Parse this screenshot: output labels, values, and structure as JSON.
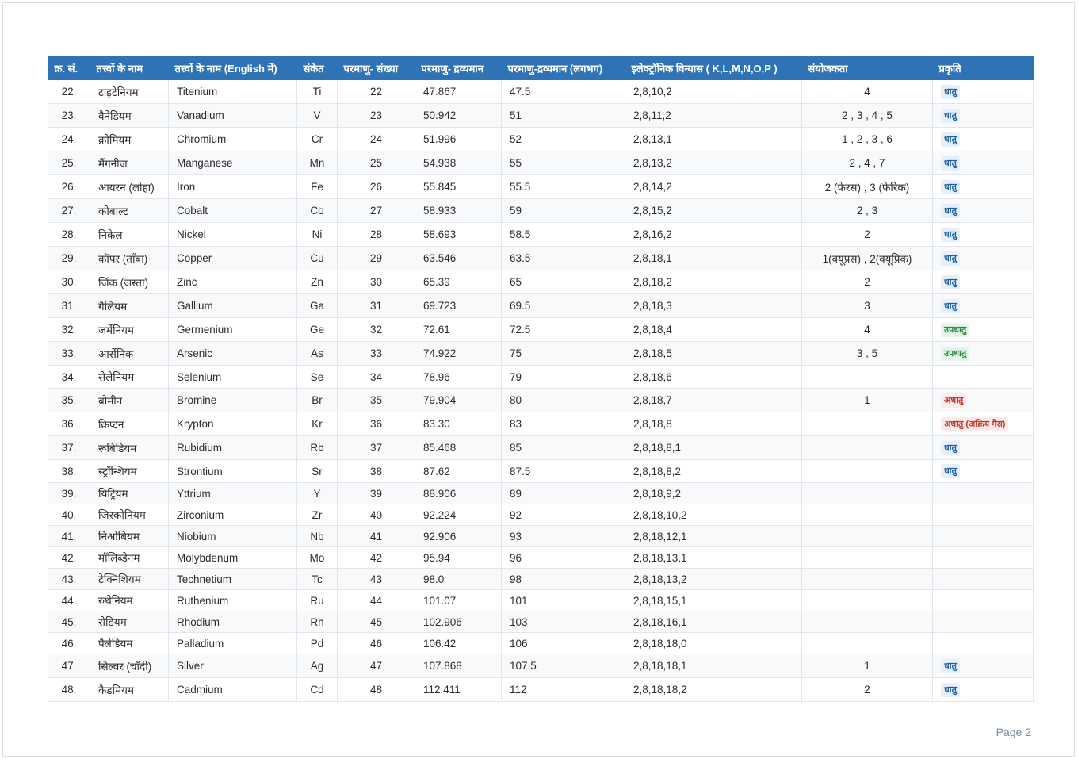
{
  "table": {
    "headers": [
      "क्र. सं.",
      "तत्त्वों के नाम",
      "तत्त्वों के नाम (English में)",
      "संकेत",
      "परमाणु- संख्या",
      "परमाणु- द्रव्यमान",
      "परमाणु-द्रव्यमान (लगभग)",
      "इलेक्ट्रॉनिक विन्यास ( K,L,M,N,O,P )",
      "संयोजकता",
      "प्रकृति"
    ],
    "rows": [
      {
        "sno": "22.",
        "hindi": "टाइटेनियम",
        "english": "Titenium",
        "symbol": "Ti",
        "number": "22",
        "mass": "47.867",
        "approx": "47.5",
        "config": "2,8,10,2",
        "valency": "4",
        "nature": "धातु",
        "nature_type": "metal"
      },
      {
        "sno": "23.",
        "hindi": "वैनेडियम",
        "english": "Vanadium",
        "symbol": "V",
        "number": "23",
        "mass": "50.942",
        "approx": "51",
        "config": "2,8,11,2",
        "valency": "2 , 3 , 4 , 5",
        "nature": "धातु",
        "nature_type": "metal"
      },
      {
        "sno": "24.",
        "hindi": "क्रोमियम",
        "english": "Chromium",
        "symbol": "Cr",
        "number": "24",
        "mass": "51.996",
        "approx": "52",
        "config": "2,8,13,1",
        "valency": "1 , 2 , 3 , 6",
        "nature": "धातु",
        "nature_type": "metal"
      },
      {
        "sno": "25.",
        "hindi": "मैंगनीज",
        "english": "Manganese",
        "symbol": "Mn",
        "number": "25",
        "mass": "54.938",
        "approx": "55",
        "config": "2,8,13,2",
        "valency": "2 , 4 , 7",
        "nature": "धातु",
        "nature_type": "metal"
      },
      {
        "sno": "26.",
        "hindi": "आयरन (लोहा)",
        "english": "Iron",
        "symbol": "Fe",
        "number": "26",
        "mass": "55.845",
        "approx": "55.5",
        "config": "2,8,14,2",
        "valency": "2 (फेरस) , 3 (फेरिक)",
        "nature": "धातु",
        "nature_type": "metal"
      },
      {
        "sno": "27.",
        "hindi": "कोबाल्ट",
        "english": "Cobalt",
        "symbol": "Co",
        "number": "27",
        "mass": "58.933",
        "approx": "59",
        "config": "2,8,15,2",
        "valency": "2 , 3",
        "nature": "धातु",
        "nature_type": "metal"
      },
      {
        "sno": "28.",
        "hindi": "निकेल",
        "english": "Nickel",
        "symbol": "Ni",
        "number": "28",
        "mass": "58.693",
        "approx": "58.5",
        "config": "2,8,16,2",
        "valency": "2",
        "nature": "धातु",
        "nature_type": "metal"
      },
      {
        "sno": "29.",
        "hindi": "कॉपर (ताँबा)",
        "english": "Copper",
        "symbol": "Cu",
        "number": "29",
        "mass": "63.546",
        "approx": "63.5",
        "config": "2,8,18,1",
        "valency": "1(क्यूप्रस) , 2(क्यूप्रिक)",
        "nature": "धातु",
        "nature_type": "metal"
      },
      {
        "sno": "30.",
        "hindi": "जिंक (जस्ता)",
        "english": "Zinc",
        "symbol": "Zn",
        "number": "30",
        "mass": "65.39",
        "approx": "65",
        "config": "2,8,18,2",
        "valency": "2",
        "nature": "धातु",
        "nature_type": "metal"
      },
      {
        "sno": "31.",
        "hindi": "गैलियम",
        "english": "Gallium",
        "symbol": "Ga",
        "number": "31",
        "mass": "69.723",
        "approx": "69.5",
        "config": "2,8,18,3",
        "valency": "3",
        "nature": "धातु",
        "nature_type": "metal"
      },
      {
        "sno": "32.",
        "hindi": "जर्मेनियम",
        "english": "Germenium",
        "symbol": "Ge",
        "number": "32",
        "mass": "72.61",
        "approx": "72.5",
        "config": "2,8,18,4",
        "valency": "4",
        "nature": "उपधातु",
        "nature_type": "metalloid"
      },
      {
        "sno": "33.",
        "hindi": "आर्सेनिक",
        "english": "Arsenic",
        "symbol": "As",
        "number": "33",
        "mass": "74.922",
        "approx": "75",
        "config": "2,8,18,5",
        "valency": "3 , 5",
        "nature": "उपधातु",
        "nature_type": "metalloid"
      },
      {
        "sno": "34.",
        "hindi": "सेलेनियम",
        "english": "Selenium",
        "symbol": "Se",
        "number": "34",
        "mass": "78.96",
        "approx": "79",
        "config": "2,8,18,6",
        "valency": "",
        "nature": "",
        "nature_type": ""
      },
      {
        "sno": "35.",
        "hindi": "ब्रोमीन",
        "english": "Bromine",
        "symbol": "Br",
        "number": "35",
        "mass": "79.904",
        "approx": "80",
        "config": "2,8,18,7",
        "valency": "1",
        "nature": "अधातु",
        "nature_type": "nonmetal"
      },
      {
        "sno": "36.",
        "hindi": "क्रिप्टन",
        "english": "Krypton",
        "symbol": "Kr",
        "number": "36",
        "mass": "83.30",
        "approx": "83",
        "config": "2,8,18,8",
        "valency": "",
        "nature": "अधातु (अक्रिय गैस)",
        "nature_type": "nonmetal"
      },
      {
        "sno": "37.",
        "hindi": "रूबिडियम",
        "english": "Rubidium",
        "symbol": "Rb",
        "number": "37",
        "mass": "85.468",
        "approx": "85",
        "config": "2,8,18,8,1",
        "valency": "",
        "nature": "धातु",
        "nature_type": "metal"
      },
      {
        "sno": "38.",
        "hindi": "स्ट्रॉन्शियम",
        "english": "Strontium",
        "symbol": "Sr",
        "number": "38",
        "mass": "87.62",
        "approx": "87.5",
        "config": "2,8,18,8,2",
        "valency": "",
        "nature": "धातु",
        "nature_type": "metal"
      },
      {
        "sno": "39.",
        "hindi": "यिट्रियम",
        "english": "Yttrium",
        "symbol": "Y",
        "number": "39",
        "mass": "88.906",
        "approx": "89",
        "config": "2,8,18,9,2",
        "valency": "",
        "nature": "",
        "nature_type": ""
      },
      {
        "sno": "40.",
        "hindi": "जिरकोनियम",
        "english": "Zirconium",
        "symbol": "Zr",
        "number": "40",
        "mass": "92.224",
        "approx": "92",
        "config": "2,8,18,10,2",
        "valency": "",
        "nature": "",
        "nature_type": ""
      },
      {
        "sno": "41.",
        "hindi": "निओबियम",
        "english": "Niobium",
        "symbol": "Nb",
        "number": "41",
        "mass": "92.906",
        "approx": "93",
        "config": "2,8,18,12,1",
        "valency": "",
        "nature": "",
        "nature_type": ""
      },
      {
        "sno": "42.",
        "hindi": "मॉलिब्डेनम",
        "english": "Molybdenum",
        "symbol": "Mo",
        "number": "42",
        "mass": "95.94",
        "approx": "96",
        "config": "2,8,18,13,1",
        "valency": "",
        "nature": "",
        "nature_type": ""
      },
      {
        "sno": "43.",
        "hindi": "टेक्निशियम",
        "english": "Technetium",
        "symbol": "Tc",
        "number": "43",
        "mass": "98.0",
        "approx": "98",
        "config": "2,8,18,13,2",
        "valency": "",
        "nature": "",
        "nature_type": ""
      },
      {
        "sno": "44.",
        "hindi": "रुथेनियम",
        "english": "Ruthenium",
        "symbol": "Ru",
        "number": "44",
        "mass": "101.07",
        "approx": "101",
        "config": "2,8,18,15,1",
        "valency": "",
        "nature": "",
        "nature_type": ""
      },
      {
        "sno": "45.",
        "hindi": "रोडियम",
        "english": "Rhodium",
        "symbol": "Rh",
        "number": "45",
        "mass": "102.906",
        "approx": "103",
        "config": "2,8,18,16,1",
        "valency": "",
        "nature": "",
        "nature_type": ""
      },
      {
        "sno": "46.",
        "hindi": "पैलेडियम",
        "english": "Palladium",
        "symbol": "Pd",
        "number": "46",
        "mass": "106.42",
        "approx": "106",
        "config": "2,8,18,18,0",
        "valency": "",
        "nature": "",
        "nature_type": ""
      },
      {
        "sno": "47.",
        "hindi": "सिल्वर (चाँदी)",
        "english": "Silver",
        "symbol": "Ag",
        "number": "47",
        "mass": "107.868",
        "approx": "107.5",
        "config": "2,8,18,18,1",
        "valency": "1",
        "nature": "धातु",
        "nature_type": "metal"
      },
      {
        "sno": "48.",
        "hindi": "कैडमियम",
        "english": "Cadmium",
        "symbol": "Cd",
        "number": "48",
        "mass": "112.411",
        "approx": "112",
        "config": "2,8,18,18,2",
        "valency": "2",
        "nature": "धातु",
        "nature_type": "metal"
      }
    ]
  },
  "footer": {
    "page_label": "Page 2"
  },
  "colors": {
    "header_bg": "#2f73b7",
    "metal": "#1f5fa8",
    "metalloid": "#2e8b3e",
    "nonmetal": "#c0392b"
  }
}
